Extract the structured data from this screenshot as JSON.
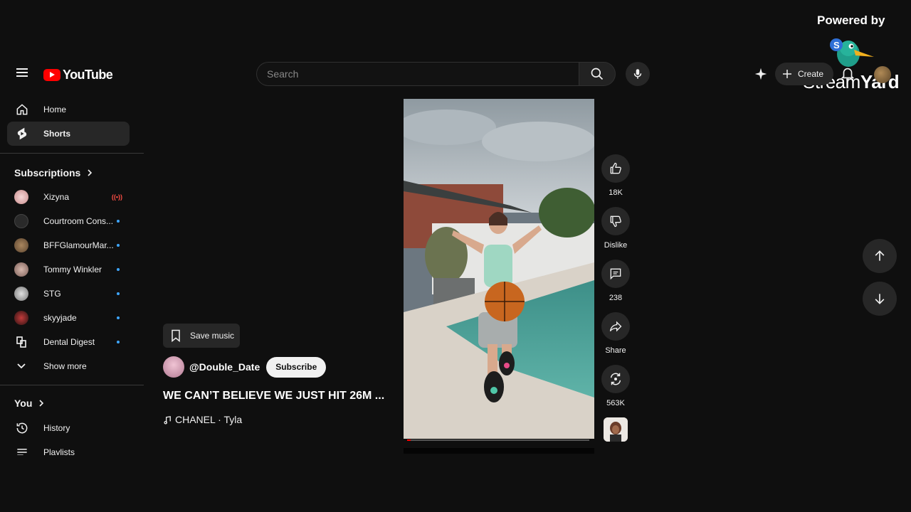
{
  "overlay": {
    "powered_by": "Powered by",
    "brand_stream": "Stream",
    "brand_yard": "Yard"
  },
  "masthead": {
    "logo_text": "YouTube",
    "search_placeholder": "Search",
    "create_label": "Create"
  },
  "sidebar": {
    "primary": [
      {
        "label": "Home",
        "icon": "home-icon"
      },
      {
        "label": "Shorts",
        "icon": "shorts-icon",
        "active": true
      }
    ],
    "subscriptions_title": "Subscriptions",
    "subscriptions": [
      {
        "name": "Xizyna",
        "status": "live"
      },
      {
        "name": "Courtroom Cons...",
        "status": "new"
      },
      {
        "name": "BFFGlamourMar...",
        "status": "new"
      },
      {
        "name": "Tommy Winkler",
        "status": "new"
      },
      {
        "name": "STG",
        "status": "new"
      },
      {
        "name": "skyyjade",
        "status": "new"
      },
      {
        "name": "Dental Digest",
        "status": "new"
      }
    ],
    "show_more": "Show more",
    "you_title": "You",
    "you_items": [
      {
        "label": "History",
        "icon": "history-icon"
      },
      {
        "label": "Playlists",
        "icon": "playlists-icon"
      }
    ]
  },
  "short": {
    "save_music": "Save music",
    "channel": "@Double_Date",
    "subscribe": "Subscribe",
    "title": "WE CAN’T BELIEVE WE JUST HIT 26M ...",
    "music": "CHANEL · Tyla",
    "progress_fraction": 0.02
  },
  "actions": {
    "likes": "18K",
    "dislike": "Dislike",
    "comments": "238",
    "share": "Share",
    "remix": "563K"
  },
  "colors": {
    "background": "#0f0f0f",
    "accent": "#ff0000",
    "surface": "#272727",
    "dot": "#3ea6ff"
  }
}
